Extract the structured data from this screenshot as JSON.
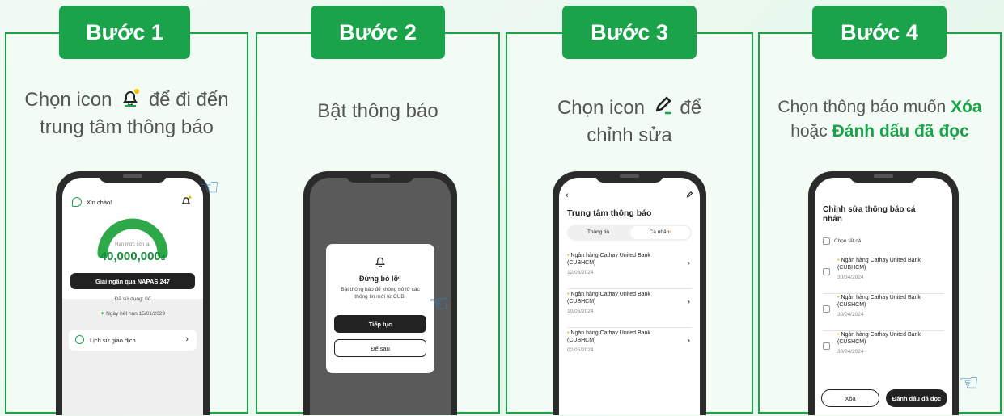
{
  "steps": [
    {
      "badge": "Bước 1",
      "desc_pre": "Chọn icon",
      "desc_mid": "để đi đến",
      "desc_line2": "trung tâm thông báo",
      "icon": "bell-icon",
      "screen": {
        "greeting": "Xin chào!",
        "limit_label": "Hạn mức còn lại",
        "limit_value": "40,000,000",
        "currency": "đ",
        "napas_button": "Giải ngân qua NAPAS 247",
        "used_label": "Đã sử dụng: 0đ",
        "expiry": "Ngày hết hạn 15/01/2029",
        "history": "Lịch sử giao dịch"
      }
    },
    {
      "badge": "Bước 2",
      "desc": "Bật thông báo",
      "screen": {
        "title": "Đừng bỏ lỡ!",
        "message": "Bật thông báo để không bỏ lỡ các thông tin mới từ CUB.",
        "continue": "Tiếp tục",
        "later": "Để sau"
      }
    },
    {
      "badge": "Bước 3",
      "desc_pre": "Chọn icon",
      "desc_mid": "để",
      "desc_line2": "chỉnh sửa",
      "icon": "pencil-icon",
      "screen": {
        "title": "Trung tâm thông báo",
        "tab_info": "Thông tin",
        "tab_personal": "Cá nhân",
        "items": [
          {
            "title": "Ngân hàng Cathay United Bank (CUBHCM)",
            "date": "12/06/2024"
          },
          {
            "title": "Ngân hàng Cathay United Bank (CUBHCM)",
            "date": "10/06/2024"
          },
          {
            "title": "Ngân hàng Cathay United Bank (CUBHCM)",
            "date": "02/05/2024"
          }
        ]
      }
    },
    {
      "badge": "Bước 4",
      "desc_l1_pre": "Chọn thông báo muốn",
      "desc_l1_hl": "Xóa",
      "desc_l2_pre": "hoặc",
      "desc_l2_hl": "Đánh dấu đã đọc",
      "screen": {
        "title": "Chỉnh sửa thông báo cá nhân",
        "select_all": "Chọn tất cả",
        "items": [
          {
            "title": "Ngân hàng Cathay United Bank (CUBHCM)",
            "date": "30/04/2024"
          },
          {
            "title": "Ngân hàng Cathay United Bank (CUSHCM)",
            "date": "30/04/2024"
          },
          {
            "title": "Ngân hàng Cathay United Bank (CUSHCM)",
            "date": "30/04/2024"
          }
        ],
        "delete": "Xóa",
        "mark_read": "Đánh dấu đã đọc"
      }
    }
  ],
  "colors": {
    "brand": "#1aa34a",
    "gauge": "#2fa84a",
    "bell": "#e8c400"
  }
}
